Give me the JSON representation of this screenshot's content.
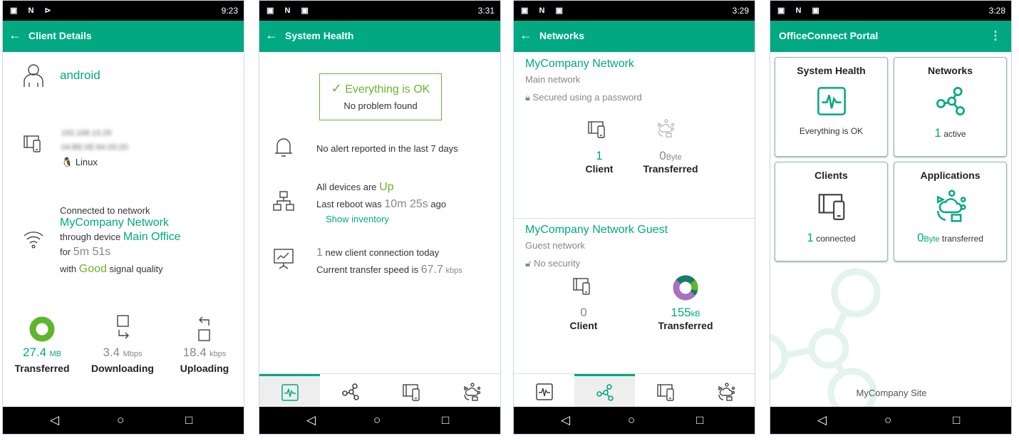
{
  "colors": {
    "accent": "#01a982",
    "good": "#6bb52e"
  },
  "screens": {
    "client": {
      "status_time": "9:23",
      "title": "Client Details",
      "name": "android",
      "ip": "192.168.13.29",
      "mac": "04:BE:0E:64:29:2D",
      "os": "Linux",
      "connected_to": "Connected to network",
      "network": "MyCompany Network",
      "through": "through device",
      "device": "Main Office",
      "for": "for",
      "duration": "5m 51s",
      "with": "with",
      "quality": "Good",
      "signal": "signal quality",
      "stats": [
        {
          "value": "27.4",
          "unit": "MB",
          "label": "Transferred",
          "icon": "donut-icon"
        },
        {
          "value": "3.4",
          "unit": "Mbps",
          "label": "Downloading",
          "icon": "download-icon"
        },
        {
          "value": "18.4",
          "unit": "kbps",
          "label": "Uploading",
          "icon": "upload-icon"
        }
      ]
    },
    "health": {
      "status_time": "3:31",
      "title": "System Health",
      "ok": "Everything is OK",
      "no_problem": "No problem found",
      "alerts": "No alert reported in the last 7 days",
      "devices_pre": "All devices are",
      "devices_state": "Up",
      "reboot_pre": "Last reboot was",
      "reboot_time": "10m 25s",
      "reboot_post": "ago",
      "inventory": "Show inventory",
      "clients_count": "1",
      "clients_text": "new client connection today",
      "speed_pre": "Current transfer speed is",
      "speed": "67.7",
      "speed_unit": "kbps"
    },
    "networks": {
      "status_time": "3:29",
      "title": "Networks",
      "items": [
        {
          "name": "MyCompany Network",
          "type": "Main network",
          "security": "Secured using a password",
          "clients": "1",
          "clients_label": "Client",
          "transferred": "0",
          "unit": "Byte",
          "transferred_label": "Transferred"
        },
        {
          "name": "MyCompany Network Guest",
          "type": "Guest network",
          "security": "No security",
          "clients": "0",
          "clients_label": "Client",
          "transferred": "155",
          "unit": "kB",
          "transferred_label": "Transferred"
        }
      ]
    },
    "portal": {
      "status_time": "3:28",
      "title": "OfficeConnect Portal",
      "site": "MyCompany Site",
      "cards": [
        {
          "title": "System Health",
          "value": "",
          "text": "Everything is OK"
        },
        {
          "title": "Networks",
          "value": "1",
          "text": "active"
        },
        {
          "title": "Clients",
          "value": "1",
          "text": "connected"
        },
        {
          "title": "Applications",
          "value": "0",
          "unit": "Byte",
          "text": "transferred"
        }
      ]
    }
  },
  "tabs": [
    "system-health",
    "networks",
    "clients",
    "applications"
  ]
}
